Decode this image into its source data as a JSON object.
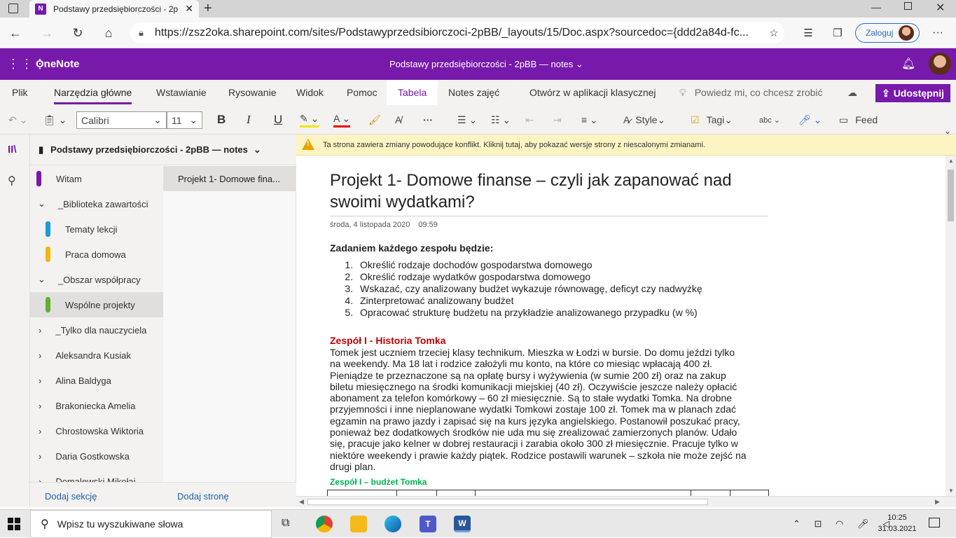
{
  "browser": {
    "tab_title": "Podstawy przedsiębiorczości - 2p",
    "url": "https://zsz2oka.sharepoint.com/sites/Podstawyprzedsibiorczoci-2pBB/_layouts/15/Doc.aspx?sourcedoc={ddd2a84d-fc...",
    "login_label": "Zaloguj"
  },
  "app": {
    "name": "OneNote",
    "notebook_title": "Podstawy przedsiębiorczości - 2pBB — notes"
  },
  "ribbon": {
    "tabs": [
      "Plik",
      "Narzędzia główne",
      "Wstawianie",
      "Rysowanie",
      "Widok",
      "Pomoc",
      "Tabela",
      "Notes zajęć",
      "Otwórz w aplikacji klasycznej"
    ],
    "tell_me": "Powiedz mi, co chcesz zrobić",
    "share": "Udostępnij"
  },
  "toolbar": {
    "font": "Calibri",
    "size": "11",
    "bold": "B",
    "italic": "I",
    "underline": "U",
    "style": "Style",
    "tags": "Tagi",
    "feed": "Feed",
    "ellipsis": "···"
  },
  "nav": {
    "notebook": "Podstawy przedsiębiorczości - 2pBB — notes",
    "sections": [
      {
        "label": "Witam",
        "color": "#7719aa"
      },
      {
        "label": "_Biblioteka zawartości"
      },
      {
        "label": "Tematy lekcji",
        "color": "#1a9bd7"
      },
      {
        "label": "Praca domowa",
        "color": "#f2b705"
      },
      {
        "label": "_Obszar współpracy"
      },
      {
        "label": "Wspólne projekty",
        "color": "#5db130"
      },
      {
        "label": "_Tylko dla nauczyciela"
      },
      {
        "label": "Aleksandra Kusiak"
      },
      {
        "label": "Alina Baldyga"
      },
      {
        "label": "Brakoniecka Amelia"
      },
      {
        "label": "Chrostowska Wiktoria"
      },
      {
        "label": "Daria Gostkowska"
      },
      {
        "label": "Domalewski Mikołaj"
      }
    ],
    "pages": [
      "Projekt 1- Domowe fina..."
    ],
    "add_section": "Dodaj sekcję",
    "add_page": "Dodaj stronę"
  },
  "conflict_message": "Ta strona zawiera zmiany powodujące konflikt. Kliknij tutaj, aby pokazać wersje strony z niescalonymi zmianami.",
  "page": {
    "title": "Projekt 1- Domowe finanse – czyli jak zapanować nad swoimi wydatkami?",
    "date": "środa, 4 listopada 2020",
    "time": "09:59",
    "task_heading": "Zadaniem każdego zespołu będzie:",
    "tasks": [
      "Określić rodzaje dochodów gospodarstwa domowego",
      "Określić rodzaje wydatków gospodarstwa domowego",
      "Wskazać, czy analizowany budżet wykazuje równowagę, deficyt czy nadwyżkę",
      "Zinterpretować analizowany budżet",
      "Opracować strukturę budżetu na przykładzie analizowanego przypadku (w %)"
    ],
    "team_heading": "Zespół I - Historia Tomka",
    "story_lines": [
      "Tomek jest uczniem trzeciej klasy technikum. Mieszka w Łodzi w bursie. Do domu jeździ tylko",
      "na weekendy. Ma 18 lat i rodzice założyli mu konto, na które co miesiąc wpłacają 400 zł.",
      "Pieniądze te przeznaczone są na opłatę bursy i wyżywienia (w sumie 200 zł) oraz na zakup",
      "biletu miesięcznego na środki komunikacji miejskiej (40 zł). Oczywiście jeszcze należy opłacić",
      "abonament za telefon komórkowy – 60 zł miesięcznie. Są to stałe wydatki Tomka. Na drobne",
      "przyjemności i inne nieplanowane wydatki Tomkowi zostaje 100 zł. Tomek ma w planach zdać",
      "egzamin na prawo jazdy i zapisać się na kurs języka angielskiego. Postanowił poszukać pracy,",
      "ponieważ bez dodatkowych środków nie uda mu się zrealizować zamierzonych planów. Udało",
      "się, pracuje jako kelner w dobrej restauracji i zarabia około 300 zł miesięcznie. Pracuje tylko w",
      "niektóre weekendy i prawie każdy piątek. Rodzice postawili warunek – szkoła nie może zejść na",
      "drugi plan."
    ],
    "budget_heading": "Zespół I – budżet Tomka"
  },
  "taskbar": {
    "search_placeholder": "Wpisz tu wyszukiwane słowa",
    "time": "10:25",
    "date": "31.03.2021"
  },
  "colors": {
    "accent": "#7719aa",
    "team_heading": "#c00000",
    "budget_heading": "#00b050",
    "link": "#1f5fab"
  }
}
